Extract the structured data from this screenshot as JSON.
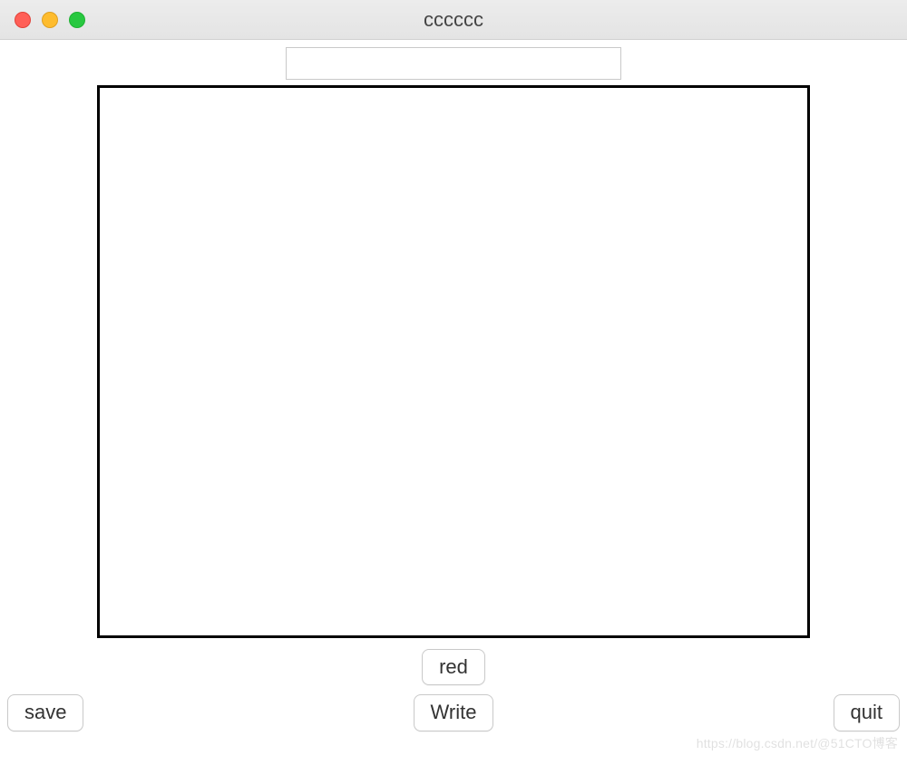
{
  "window": {
    "title": "cccccc"
  },
  "inputs": {
    "entry_value": "",
    "entry_placeholder": "",
    "textarea_value": ""
  },
  "buttons": {
    "red_label": "red",
    "save_label": "save",
    "write_label": "Write",
    "quit_label": "quit"
  },
  "watermark": "https://blog.csdn.net/@51CTO博客"
}
